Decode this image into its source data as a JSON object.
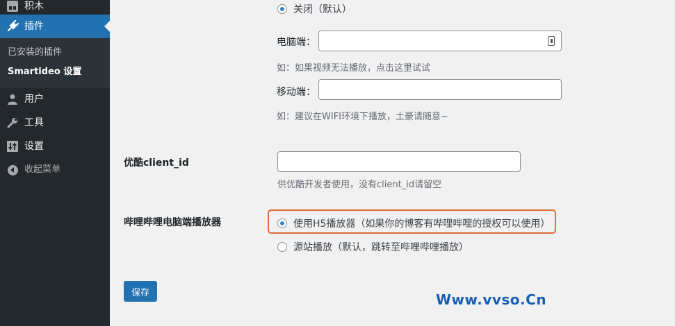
{
  "sidebar": {
    "items": [
      {
        "label": "积木",
        "icon": "blocks-icon"
      },
      {
        "label": "插件",
        "icon": "plugin-icon",
        "active": true
      },
      {
        "label": "用户",
        "icon": "user-icon"
      },
      {
        "label": "工具",
        "icon": "wrench-icon"
      },
      {
        "label": "设置",
        "icon": "settings-icon"
      },
      {
        "label": "收起菜单",
        "icon": "collapse-icon"
      }
    ],
    "submenu": [
      {
        "label": "已安装的插件"
      },
      {
        "label": "Smartideo 设置",
        "current": true
      }
    ],
    "colors": {
      "background": "#23282d",
      "active": "#2271b1",
      "submenu": "#2c3338"
    }
  },
  "form": {
    "autoplay_off_label": "关闭（默认）",
    "pc_label": "电脑端：",
    "pc_value": "",
    "pc_desc": "如：如果视频无法播放，点击这里试试",
    "mobile_label": "移动端：",
    "mobile_value": "",
    "mobile_desc": "如：建议在WIFI环境下播放，土豪请随意~",
    "youku": {
      "heading": "优酷client_id",
      "value": "",
      "desc": "供优酷开发者使用，没有client_id请留空"
    },
    "bilibili": {
      "heading": "哔哩哔哩电脑端播放器",
      "options": [
        {
          "label": "使用H5播放器（如果你的博客有哔哩哔哩的授权可以使用）",
          "checked": true
        },
        {
          "label": "源站播放（默认，跳转至哔哩哔哩播放）",
          "checked": false
        }
      ]
    },
    "save_label": "保存"
  },
  "watermark": "Www.vvso.Cn",
  "colors": {
    "accent": "#2271b1",
    "highlight": "#e06a3b",
    "radio_dot": "#3582c4"
  }
}
